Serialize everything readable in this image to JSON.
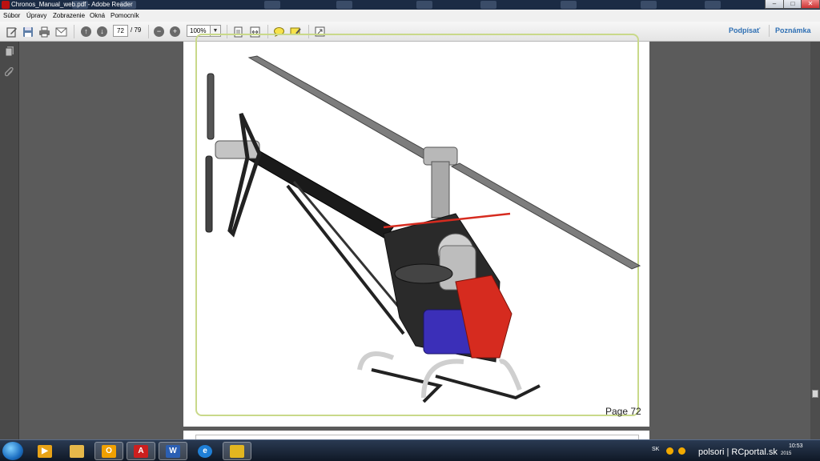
{
  "window": {
    "title": "Chronos_Manual_web.pdf - Adobe Reader",
    "min_label": "–",
    "max_label": "□",
    "close_label": "✕"
  },
  "menu": {
    "items": [
      {
        "label": "Súbor"
      },
      {
        "label": "Úpravy"
      },
      {
        "label": "Zobrazenie"
      },
      {
        "label": "Okná"
      },
      {
        "label": "Pomocník"
      }
    ]
  },
  "toolbar": {
    "page_current": "72",
    "page_total": "/ 79",
    "zoom_value": "100%",
    "sign_label": "Podpísať",
    "note_label": "Poznámka",
    "icons": [
      "edit-icon",
      "save-icon",
      "print-icon",
      "email-icon",
      "prev-page-icon",
      "next-page-icon",
      "zoom-out-icon",
      "zoom-in-icon",
      "fit-page-icon",
      "fit-width-icon",
      "comment-icon",
      "highlight-icon",
      "expand-icon"
    ]
  },
  "document": {
    "page_label": "Page 72",
    "image_subject": "Chronos model helicopter"
  },
  "taskbar": {
    "apps": [
      {
        "name": "media-player",
        "color": "#e8a317"
      },
      {
        "name": "file-explorer",
        "color": "#e6b84a"
      },
      {
        "name": "outlook",
        "color": "#f0a000"
      },
      {
        "name": "adobe-reader",
        "color": "#cc1f1f"
      },
      {
        "name": "word",
        "color": "#2b5fb3"
      },
      {
        "name": "internet-explorer",
        "color": "#1f7fd6"
      },
      {
        "name": "paint-shop",
        "color": "#e3b620"
      }
    ],
    "language": "SK",
    "watermark": "polsori | RCportal.sk",
    "time": "10:53",
    "date": "2015"
  },
  "colors": {
    "page_border": "#c9d98a",
    "link_blue": "#2e6fb3",
    "helicopter_red": "#d62b1f",
    "helicopter_blue": "#3b2fb8"
  }
}
